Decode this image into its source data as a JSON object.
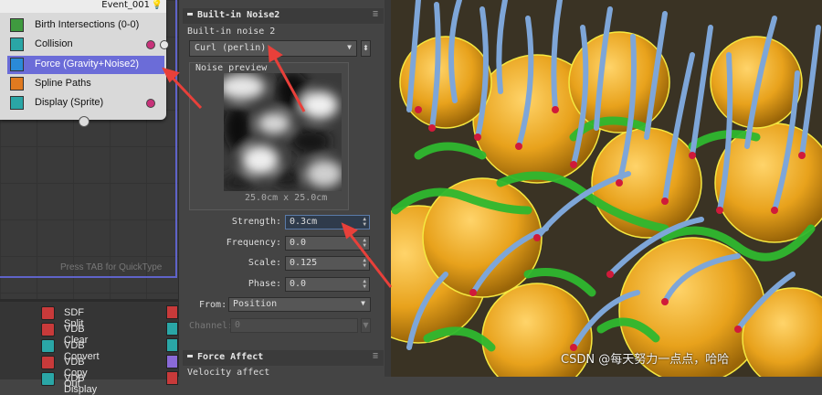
{
  "particle_view": {
    "event_title": "Event_001",
    "operators": [
      {
        "label": "Birth Intersections (0-0)",
        "icon_color": "#3f9a3f"
      },
      {
        "label": "Collision",
        "icon_color": "#2aa6a6"
      },
      {
        "label": "Force (Gravity+Noise2)",
        "icon_color": "#2a8ad8"
      },
      {
        "label": "Spline Paths",
        "icon_color": "#e07a20"
      },
      {
        "label": "Display (Sprite)",
        "icon_color": "#2aa6a6"
      }
    ],
    "quicktype_hint": "Press TAB for QuickType",
    "depot": [
      {
        "label": "SDF Split",
        "icon_color": "#c83a3a"
      },
      {
        "label": "VDB Clear",
        "icon_color": "#c83a3a"
      },
      {
        "label": "VDB Convert",
        "icon_color": "#2aa6a6"
      },
      {
        "label": "VDB Copy Out",
        "icon_color": "#c83a3a"
      },
      {
        "label": "VDB Display",
        "icon_color": "#2aa6a6"
      }
    ]
  },
  "panel": {
    "rollout_title": "Built-in Noise2",
    "group_label": "Built-in noise 2",
    "noise_type": "Curl (perlin)",
    "preview_label": "Noise preview",
    "preview_size": "25.0cm x 25.0cm",
    "params": [
      {
        "label": "Strength:",
        "value": "0.3cm"
      },
      {
        "label": "Frequency:",
        "value": "0.0"
      },
      {
        "label": "Scale:",
        "value": "0.125"
      },
      {
        "label": "Phase:",
        "value": "0.0"
      }
    ],
    "from_label": "From:",
    "from_value": "Position",
    "channel_label": "Channel:",
    "channel_value": "0",
    "rollout2_title": "Force Affect",
    "velocity_label": "Velocity affect"
  },
  "viewport": {
    "watermark": "CSDN @每天努力一点点，哈哈"
  },
  "colors": {
    "selection": "#6b6cd8",
    "frame": "#5f63c9",
    "annotation_arrow": "#e8403a",
    "sphere": "#e8a21c",
    "foam": "#2fb82f",
    "tubes": "#7ea6d8"
  }
}
